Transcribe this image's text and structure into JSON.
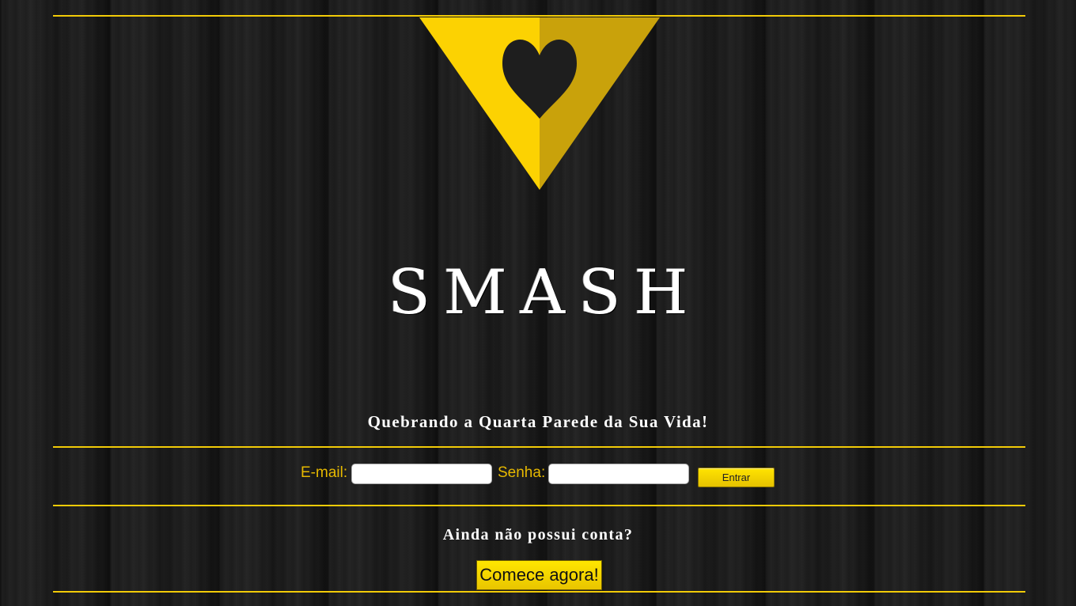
{
  "brand": {
    "logo_icon": "heart-triangle-icon",
    "name": "SMASH",
    "tagline": "Quebrando a Quarta Parede da Sua Vida!"
  },
  "login": {
    "email_label": "E-mail:",
    "email_value": "",
    "password_label": "Senha:",
    "password_value": "",
    "submit_label": "Entrar"
  },
  "signup": {
    "question": "Ainda não possui conta?",
    "cta_label": "Comece agora!"
  },
  "colors": {
    "accent": "#f2cb07",
    "accent_dark": "#c9a20b",
    "label": "#e6b800",
    "background": "#1d1d1d",
    "text": "#ffffff"
  }
}
